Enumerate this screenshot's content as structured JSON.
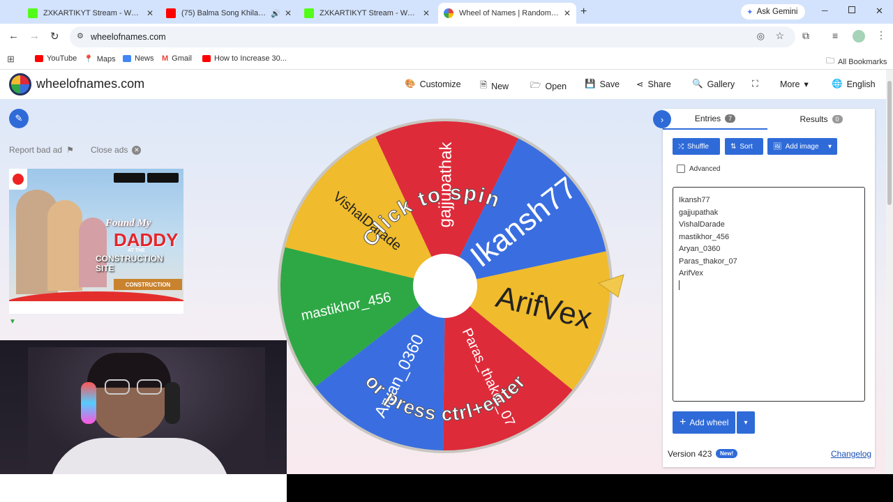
{
  "browser": {
    "tabs": [
      {
        "label": "ZXKARTIKYT Stream - Watch Li",
        "color": "#53fc18"
      },
      {
        "label": "(75) Balma Song Khiladi 786",
        "color": "#ff0000"
      },
      {
        "label": "ZXKARTIKYT Stream - Watch Li",
        "color": "#53fc18"
      },
      {
        "label": "Wheel of Names | Random nam",
        "color": "#4285f4"
      }
    ],
    "gemini_label": "Ask Gemini",
    "url": "wheelofnames.com",
    "bookmarks": [
      "YouTube",
      "Maps",
      "News",
      "Gmail",
      "How to Increase 30..."
    ],
    "all_bookmarks": "All Bookmarks"
  },
  "site": {
    "title": "wheelofnames.com",
    "menu": [
      "Customize",
      "New",
      "Open",
      "Save",
      "Share",
      "Gallery",
      "More",
      "English"
    ]
  },
  "ads": {
    "report": "Report bad ad",
    "close": "Close ads",
    "banner_line1": "Found My",
    "banner_line2": "DADDY",
    "banner_line3": "AT THE",
    "banner_line4": "CONSTRUCTION SITE",
    "banner_sign": "CONSTRUCTION"
  },
  "wheel": {
    "spin_text_top": "Click to spin",
    "spin_text_bottom": "or press ctrl+enter",
    "segments": [
      {
        "name": "gajjupathak",
        "color": "#de2b3a"
      },
      {
        "name": "Ikansh77",
        "color": "#3a6ee0"
      },
      {
        "name": "ArifVex",
        "color": "#f0bb2c"
      },
      {
        "name": "Paras_thakor_07",
        "color": "#de2b3a"
      },
      {
        "name": "Aryan_0360",
        "color": "#3a6ee0"
      },
      {
        "name": "mastikhor_456",
        "color": "#2ea845"
      },
      {
        "name": "VishalDarade",
        "color": "#f0bb2c"
      }
    ]
  },
  "panel": {
    "entries_label": "Entries",
    "entries_count": "7",
    "results_label": "Results",
    "results_count": "0",
    "shuffle": "Shuffle",
    "sort": "Sort",
    "add_image": "Add image",
    "advanced": "Advanced",
    "entries": [
      "Ikansh77",
      "gajjupathak",
      "VishalDarade",
      "mastikhor_456",
      "Aryan_0360",
      "Paras_thakor_07",
      "ArifVex"
    ],
    "add_wheel": "Add wheel",
    "version": "Version 423",
    "new_badge": "New!",
    "changelog": "Changelog"
  }
}
